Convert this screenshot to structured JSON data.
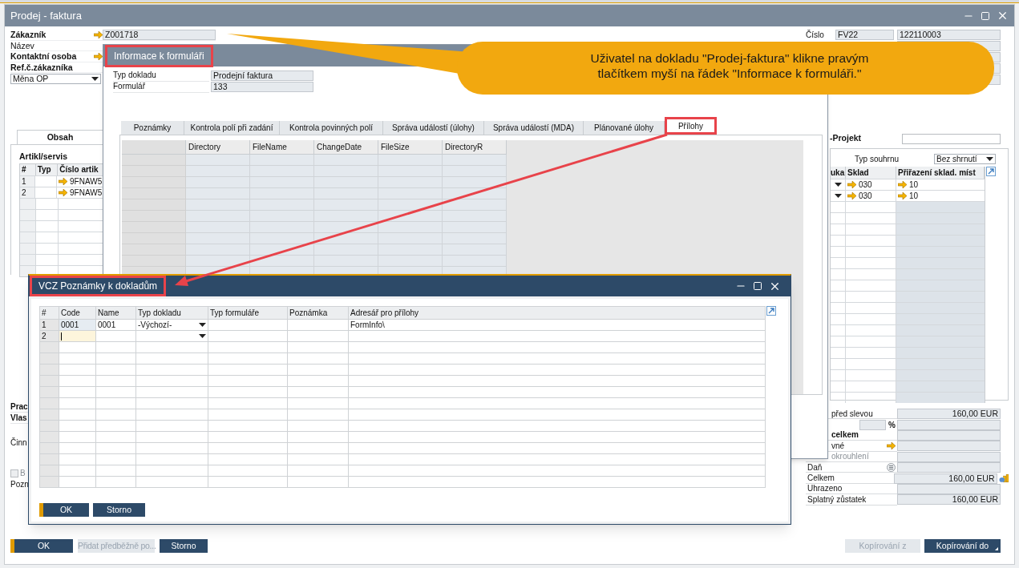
{
  "main_window": {
    "title": "Prodej - faktura",
    "customer_fields": [
      {
        "label": "Zákazník",
        "bold": true,
        "link": true,
        "value": "Z001718"
      },
      {
        "label": "Název",
        "bold": false,
        "link": false
      },
      {
        "label": "Kontaktní osoba",
        "bold": true,
        "link": true
      },
      {
        "label": "Ref.č.zákazníka",
        "bold": true,
        "link": false
      }
    ],
    "currency_select": "Měna OP",
    "tabs": [
      {
        "label": "Obsah",
        "selected": true
      }
    ],
    "items_section": "Artikl/servis",
    "items_table": {
      "columns": [
        "#",
        "Typ",
        "Číslo artik"
      ],
      "rows": [
        {
          "num": "1",
          "item": "9FNAW5"
        },
        {
          "num": "2",
          "item": "9FNAW5"
        }
      ]
    },
    "lower_left": [
      {
        "kind": "bold",
        "text": "Prac"
      },
      {
        "kind": "bold",
        "text": "Vlas"
      },
      {
        "kind": "label",
        "text": "Činn"
      },
      {
        "kind": "checkbox",
        "text": "B",
        "checked": false
      },
      {
        "kind": "label",
        "text": "Pozn"
      }
    ],
    "doc_number": {
      "label": "Číslo",
      "series": "FV22",
      "number": "122110003"
    },
    "project_label": "-Projekt",
    "summary_type": {
      "label": "Typ souhrnu",
      "value": "Bez shrnutí"
    },
    "warehouse_table": {
      "columns": [
        "uka",
        "Sklad",
        "Přiřazení sklad. míst"
      ],
      "rows": [
        {
          "warehouse": "030",
          "bin": "10"
        },
        {
          "warehouse": "030",
          "bin": "10"
        }
      ]
    },
    "totals": [
      {
        "kind": "plain",
        "label": "před slevou",
        "partial": true,
        "value": "160,00 EUR"
      },
      {
        "kind": "percent",
        "unit": "%"
      },
      {
        "kind": "bold",
        "label": "celkem",
        "partial": true
      },
      {
        "kind": "link",
        "label": "vné",
        "partial": true
      },
      {
        "kind": "disabled",
        "label": "okrouhlení",
        "partial": true
      },
      {
        "kind": "info",
        "label": "Daň",
        "partial": false
      },
      {
        "kind": "total",
        "label": "Celkem",
        "partial": false,
        "value": "160,00 EUR"
      },
      {
        "kind": "plain",
        "label": "Uhrazeno",
        "partial": false
      },
      {
        "kind": "plain",
        "label": "Splatný zůstatek",
        "partial": false,
        "value": "160,00 EUR"
      }
    ],
    "buttons_left": [
      {
        "label": "OK",
        "kind": "primary",
        "disabled": false
      },
      {
        "label": "Přidat předběžně po...",
        "kind": "normal",
        "disabled": true
      },
      {
        "label": "Storno",
        "kind": "normal",
        "disabled": false
      }
    ],
    "buttons_right": [
      {
        "label": "Kopírování z",
        "kind": "normal",
        "disabled": true
      },
      {
        "label": "Kopírování do",
        "kind": "menu",
        "disabled": false
      }
    ]
  },
  "info_window": {
    "title": "Informace k formuláři",
    "fields": [
      {
        "label": "Typ dokladu",
        "value": "Prodejní faktura"
      },
      {
        "label": "Formulář",
        "value": "133"
      }
    ],
    "tabs": [
      {
        "label": "Poznámky",
        "selected": false
      },
      {
        "label": "Kontrola polí při zadání",
        "selected": false
      },
      {
        "label": "Kontrola povinných polí",
        "selected": false
      },
      {
        "label": "Správa událostí (úlohy)",
        "selected": false
      },
      {
        "label": "Správa událostí (MDA)",
        "selected": false
      },
      {
        "label": "Plánované úlohy",
        "selected": false
      },
      {
        "label": "Přílohy",
        "selected": true
      }
    ],
    "grid_columns": [
      "Directory",
      "FileName",
      "ChangeDate",
      "FileSize",
      "DirectoryR"
    ]
  },
  "callout": {
    "lines": [
      "Uživatel na dokladu \"Prodej-faktura\" klikne pravým",
      "tlačítkem myší na řádek \"Informace k formuláři.\""
    ]
  },
  "notes_dialog": {
    "title": "VCZ Poznámky k dokladům",
    "columns": [
      "#",
      "Code",
      "Name",
      "Typ dokladu",
      "Typ formuláře",
      "Poznámka",
      "Adresář pro přílohy"
    ],
    "rows": [
      {
        "num": "1",
        "code": "0001",
        "name": "0001",
        "doc_type": "-Výchozí-",
        "folder": "FormInfo\\",
        "editing": false
      },
      {
        "num": "2",
        "editing": true
      }
    ],
    "buttons": [
      {
        "label": "OK",
        "kind": "primary"
      },
      {
        "label": "Storno",
        "kind": "normal"
      }
    ]
  }
}
